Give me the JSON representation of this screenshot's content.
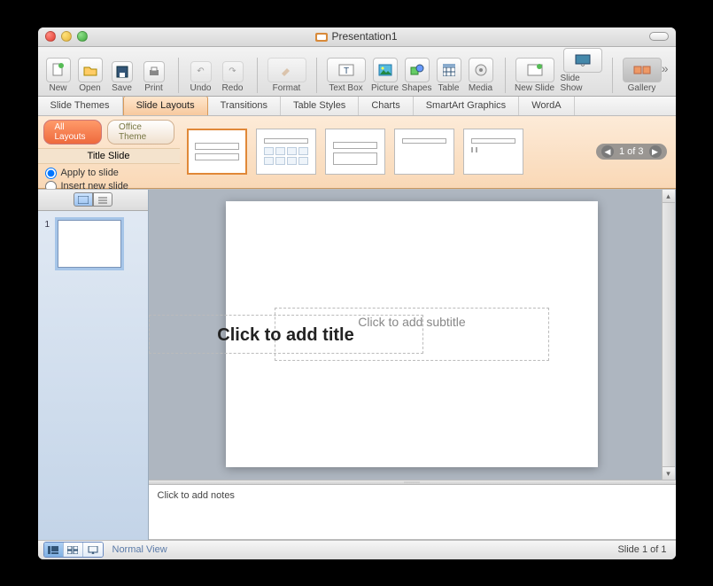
{
  "window": {
    "title": "Presentation1"
  },
  "toolbar": {
    "new": "New",
    "open": "Open",
    "save": "Save",
    "print": "Print",
    "undo": "Undo",
    "redo": "Redo",
    "format": "Format",
    "textbox": "Text Box",
    "picture": "Picture",
    "shapes": "Shapes",
    "table": "Table",
    "media": "Media",
    "newslide": "New Slide",
    "slideshow": "Slide Show",
    "gallery": "Gallery"
  },
  "ribbon": {
    "tabs": [
      "Slide Themes",
      "Slide Layouts",
      "Transitions",
      "Table Styles",
      "Charts",
      "SmartArt Graphics",
      "WordA"
    ],
    "active_index": 1,
    "chips": {
      "all": "All Layouts",
      "theme": "Office Theme"
    },
    "subhead": "Title Slide",
    "apply_label": "Apply to slide",
    "insert_label": "Insert new slide",
    "apply_selected": true,
    "pager": "1 of 3"
  },
  "sidebar": {
    "slide_numbers": [
      "1"
    ]
  },
  "canvas": {
    "title_placeholder": "Click to add title",
    "subtitle_placeholder": "Click to add subtitle"
  },
  "notes": {
    "placeholder": "Click to add notes"
  },
  "status": {
    "view": "Normal View",
    "slide_of": "Slide 1 of 1"
  }
}
